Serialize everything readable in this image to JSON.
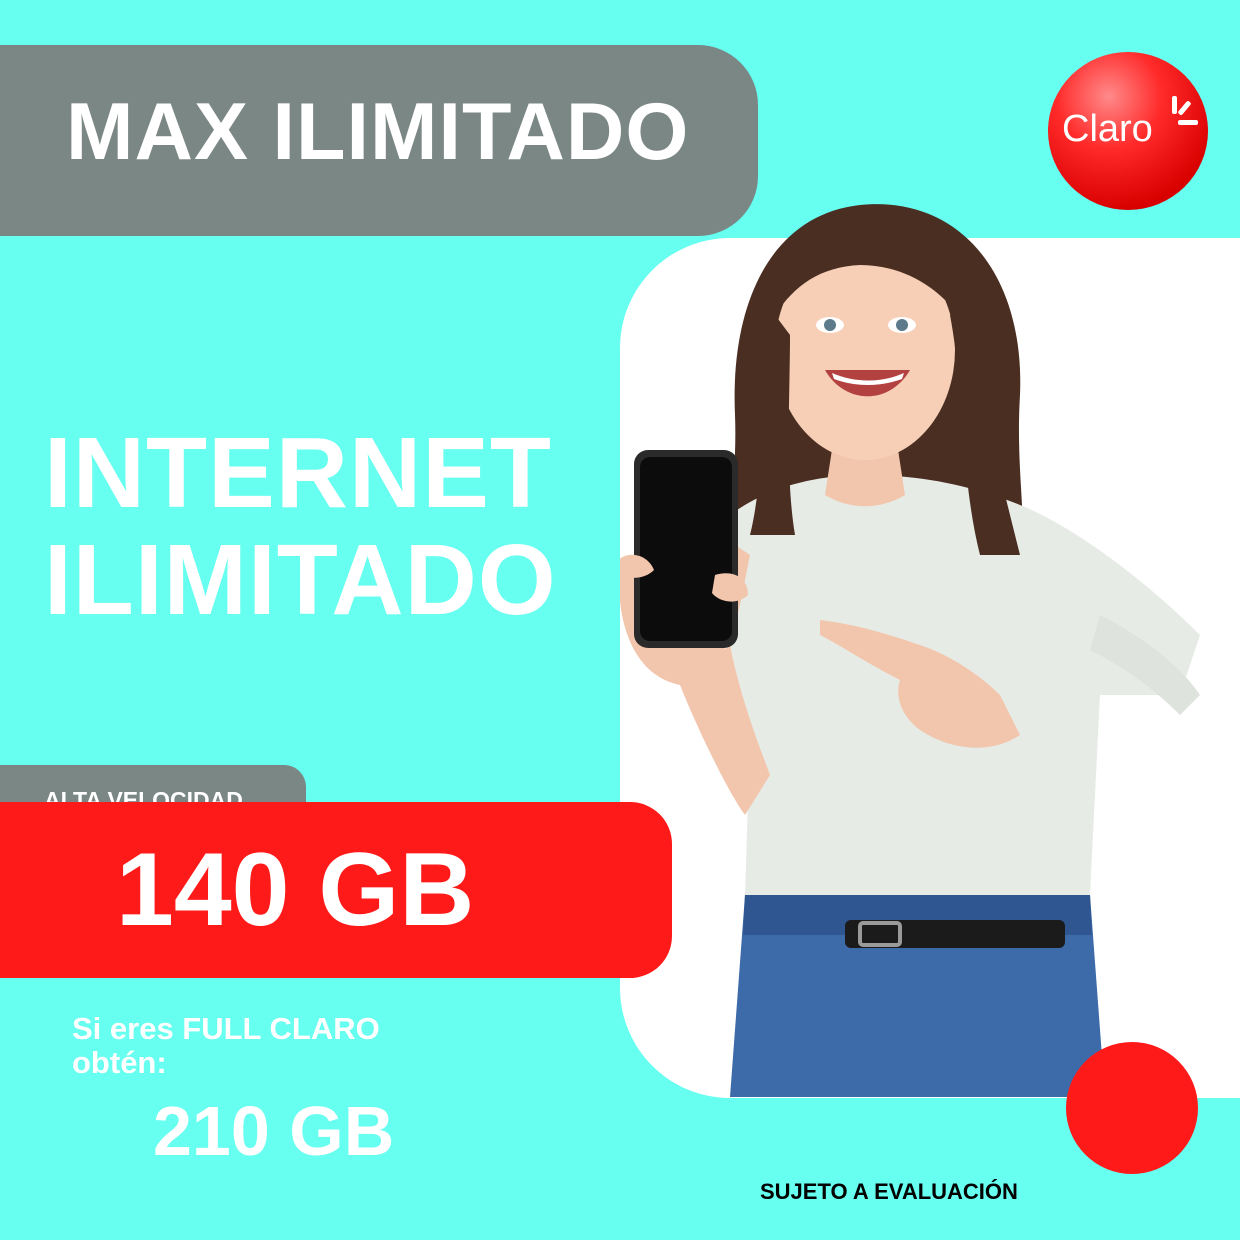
{
  "banner": {
    "title": "MAX ILIMITADO"
  },
  "brand": {
    "logo_text": "Claro",
    "color": "#ff1a1a"
  },
  "headline": {
    "line1": "INTERNET",
    "line2": "ILIMITADO"
  },
  "speed": {
    "tag": "ALTA VELOCIDAD",
    "amount": "140 GB"
  },
  "full_claro": {
    "line1": "Si eres FULL CLARO",
    "line2": "obtén:",
    "amount": "210 GB"
  },
  "footer": {
    "disclaimer": "SUJETO A EVALUACIÓN"
  },
  "colors": {
    "background": "#66fff0",
    "gray": "#7b8785",
    "red": "#ff1a1a",
    "white": "#ffffff"
  }
}
